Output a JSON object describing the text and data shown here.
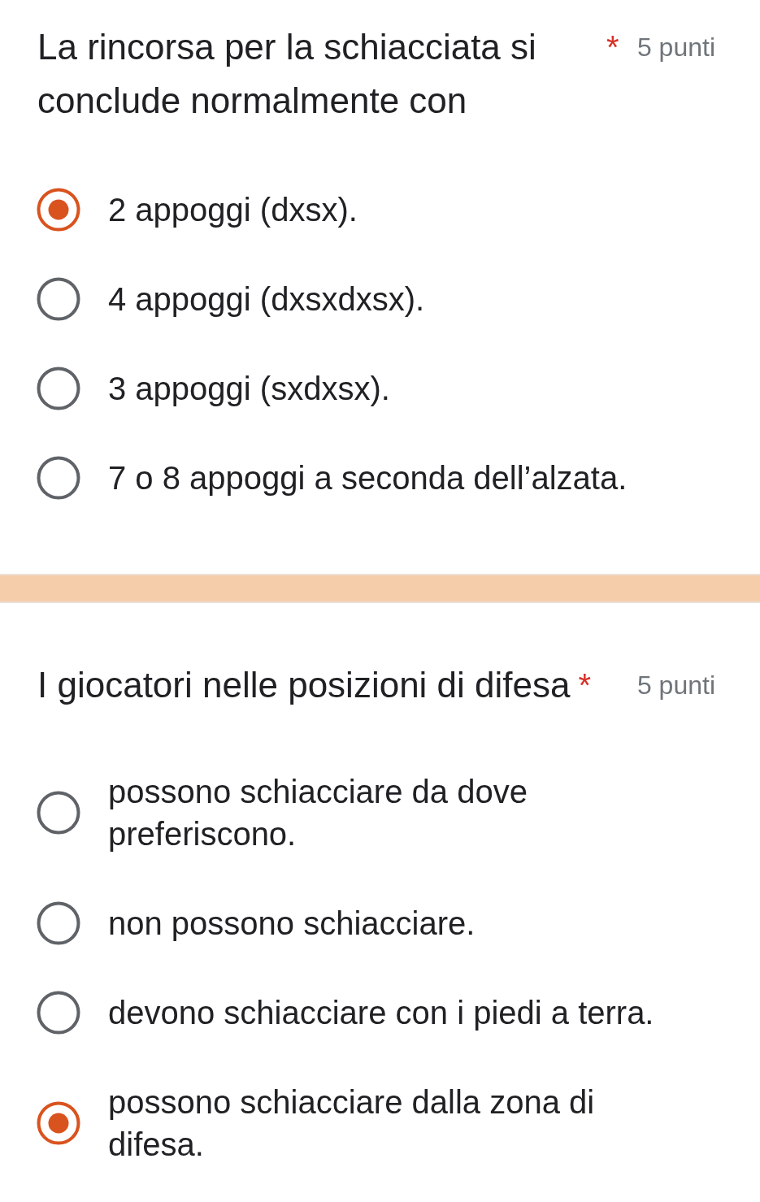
{
  "questions": [
    {
      "title": "La rincorsa per la schiacciata si conclude normalmente con",
      "required_mark": "*",
      "points": "5 punti",
      "options": [
        {
          "label": "2 appoggi (dxsx).",
          "selected": true
        },
        {
          "label": "4 appoggi (dxsxdxsx).",
          "selected": false
        },
        {
          "label": "3 appoggi (sxdxsx).",
          "selected": false
        },
        {
          "label": "7 o 8 appoggi a seconda dell’alzata.",
          "selected": false
        }
      ]
    },
    {
      "title": "I giocatori nelle posizioni di difesa",
      "required_mark": "*",
      "points": "5 punti",
      "options": [
        {
          "label": "possono schiacciare da dove preferiscono.",
          "selected": false
        },
        {
          "label": "non possono schiacciare.",
          "selected": false
        },
        {
          "label": "devono schiacciare con i piedi a terra.",
          "selected": false
        },
        {
          "label": "possono schiacciare dalla zona di difesa.",
          "selected": true
        }
      ]
    }
  ]
}
